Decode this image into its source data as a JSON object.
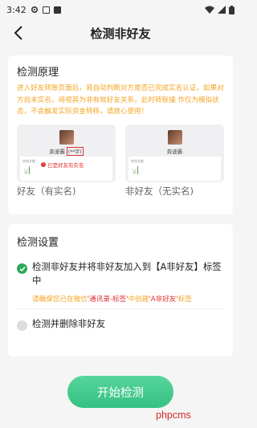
{
  "status_bar": {
    "time": "3:42",
    "icons": [
      "gear-icon",
      "square-icon",
      "text-a-icon"
    ],
    "right_icons": [
      "wifi-icon",
      "signal-icon",
      "battery-icon"
    ]
  },
  "nav": {
    "title": "检测非好友"
  },
  "principle": {
    "title": "检测原理",
    "warning": "进入好友转账页面后，将自动判断对方是否已完成实名认证。如果对方尚未实名，将视其为非有效好友关系，此时转账操 作仅为模拟状态，不会触发实际资金转移，请放心使用！",
    "demos": [
      {
        "name": "奔波霸",
        "tag": "(**宇)",
        "input_label": "转账金额",
        "yen": "￥",
        "note": "已是好友有实名",
        "caption": "好友（有实名)"
      },
      {
        "name": "奔波霸",
        "tag": "",
        "input_label": "转账金额",
        "yen": "￥",
        "note": "",
        "caption": "非好友（无实名)"
      }
    ]
  },
  "settings": {
    "title": "检测设置",
    "option1": "检测非好友并将非好友加入到【A非好友】标签中",
    "hint_a": "请确保您已在微信",
    "hint_b": "'通讯录-标签'",
    "hint_c": "中创建",
    "hint_d": "'A非好友'",
    "hint_e": "标签",
    "option2": "检测并删除非好友"
  },
  "start_button": "开始检测",
  "watermark": "phpcms",
  "colors": {
    "accent": "#35c182",
    "warning": "#f5a524",
    "alert": "#e03030"
  }
}
